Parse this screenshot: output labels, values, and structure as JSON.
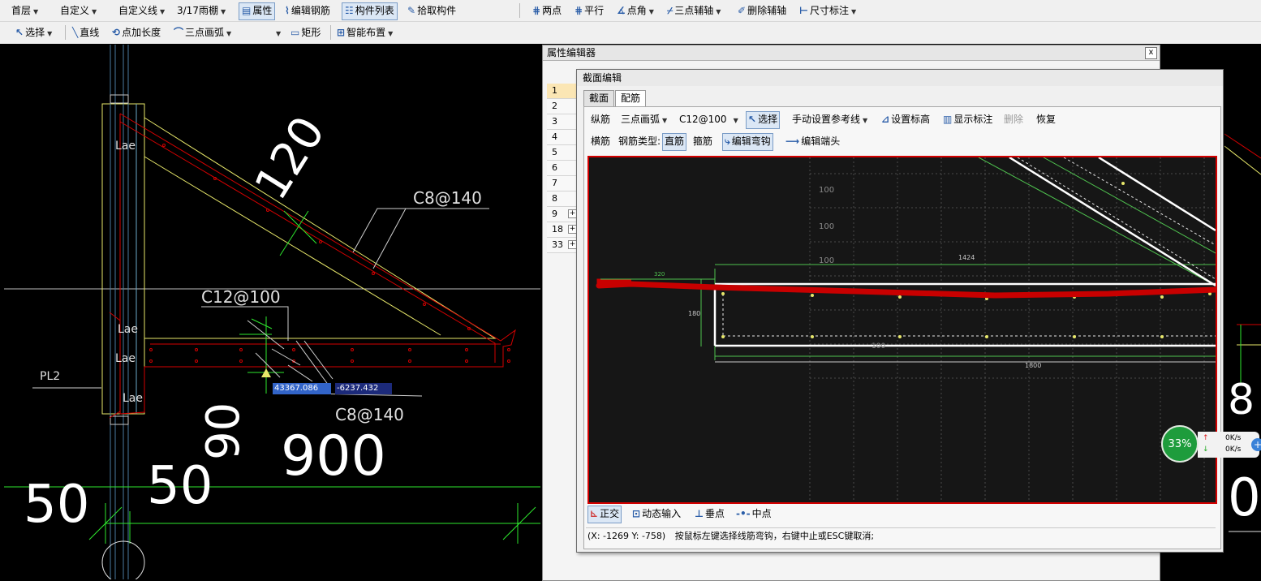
{
  "toolbar1": {
    "floor": "首层",
    "custom": "自定义",
    "custom_line": "自定义线",
    "component": "3/17雨棚",
    "attr": "属性",
    "edit_rebar": "编辑钢筋",
    "component_list": "构件列表",
    "pick_component": "拾取构件",
    "two_points": "两点",
    "parallel": "平行",
    "point_angle": "点角",
    "three_point_axis": "三点辅轴",
    "delete_axis": "删除辅轴",
    "dim_label": "尺寸标注"
  },
  "toolbar2": {
    "select": "选择",
    "line": "直线",
    "point_length": "点加长度",
    "three_point_arc": "三点画弧",
    "rect": "矩形",
    "smart_layout": "智能布置"
  },
  "cad": {
    "labels": {
      "lae1": "Lae",
      "lae2": "Lae",
      "lae3": "Lae",
      "lae4": "Lae",
      "pl2": "PL2",
      "c8_1": "C8@140",
      "c12": "C12@100",
      "c8_2": "C8@140",
      "d120": "120",
      "d90": "90",
      "d900": "900",
      "d50a": "50",
      "d50b": "50"
    },
    "coord_x": "43367.086",
    "coord_y": "-6237.432"
  },
  "property_editor": {
    "title": "属性编辑器",
    "close": "x",
    "rows": [
      {
        "num": "1",
        "expand": ""
      },
      {
        "num": "2",
        "expand": ""
      },
      {
        "num": "3",
        "expand": ""
      },
      {
        "num": "4",
        "expand": ""
      },
      {
        "num": "5",
        "expand": ""
      },
      {
        "num": "6",
        "expand": ""
      },
      {
        "num": "7",
        "expand": ""
      },
      {
        "num": "8",
        "expand": ""
      },
      {
        "num": "9",
        "expand": "+"
      },
      {
        "num": "18",
        "expand": "+"
      },
      {
        "num": "33",
        "expand": "+"
      }
    ]
  },
  "section_editor": {
    "title": "截面编辑",
    "tabs": [
      "截面",
      "配筋"
    ],
    "row1": {
      "longitudinal": "纵筋",
      "arc_mode": "三点画弧",
      "spec": "C12@100",
      "select": "选择",
      "manual_ref": "手动设置参考线",
      "set_elevation": "设置标高",
      "show_label": "显示标注",
      "delete": "删除",
      "restore": "恢复"
    },
    "row2": {
      "transverse": "横筋",
      "rebar_type": "钢筋类型:",
      "straight": "直筋",
      "stirrup": "箍筋",
      "edit_hook": "编辑弯钩",
      "edit_end": "编辑端头"
    },
    "canvas": {
      "grid_labels": [
        "100",
        "100",
        "100"
      ],
      "dim_top": "1424",
      "dim_left": "320",
      "dim_height": "180",
      "dim_bottom": "1800",
      "spacing_label": "100"
    },
    "bottom": {
      "ortho": "正交",
      "dynamic_input": "动态输入",
      "perpendicular": "垂点",
      "midpoint": "中点"
    },
    "status_coords": "(X: -1269 Y: -758)",
    "status_message": "按鼠标左键选择线筋弯钩，右键中止或ESC键取消;"
  },
  "net_widget": {
    "percent": "33%",
    "upload": "0K/s",
    "download": "0K/s"
  },
  "colors": {
    "cad_bg": "#000000",
    "rebar_red": "#d40000",
    "outline_yellow": "#e8e86a",
    "guide_green": "#2ee82e"
  }
}
